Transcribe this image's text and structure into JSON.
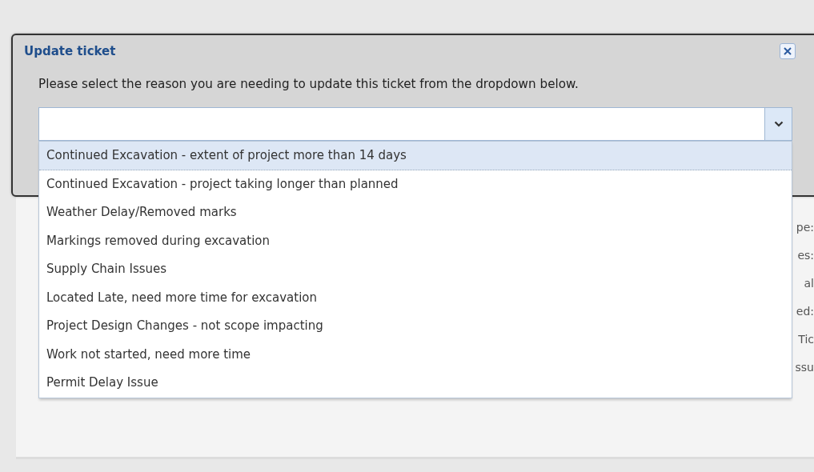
{
  "background_labels": [
    "pe:",
    "es:",
    "al",
    "ed:",
    "Tic",
    "ssu"
  ],
  "dialog": {
    "title": "Update ticket",
    "message": "Please select the reason you are needing to update this ticket from the dropdown below.",
    "dropdown": {
      "expanded": true,
      "options": [
        {
          "label": "Continued Excavation - extent of project more than 14 days",
          "selected": true
        },
        {
          "label": "Continued Excavation - project taking longer than planned",
          "selected": false
        },
        {
          "label": "Weather Delay/Removed marks",
          "selected": false
        },
        {
          "label": "Markings removed during excavation",
          "selected": false
        },
        {
          "label": "Supply Chain Issues",
          "selected": false
        },
        {
          "label": "Located Late, need more time for excavation",
          "selected": false
        },
        {
          "label": "Project Design Changes - not scope impacting",
          "selected": false
        },
        {
          "label": "Work not started, need more time",
          "selected": false
        },
        {
          "label": "Permit Delay Issue",
          "selected": false
        }
      ]
    }
  }
}
